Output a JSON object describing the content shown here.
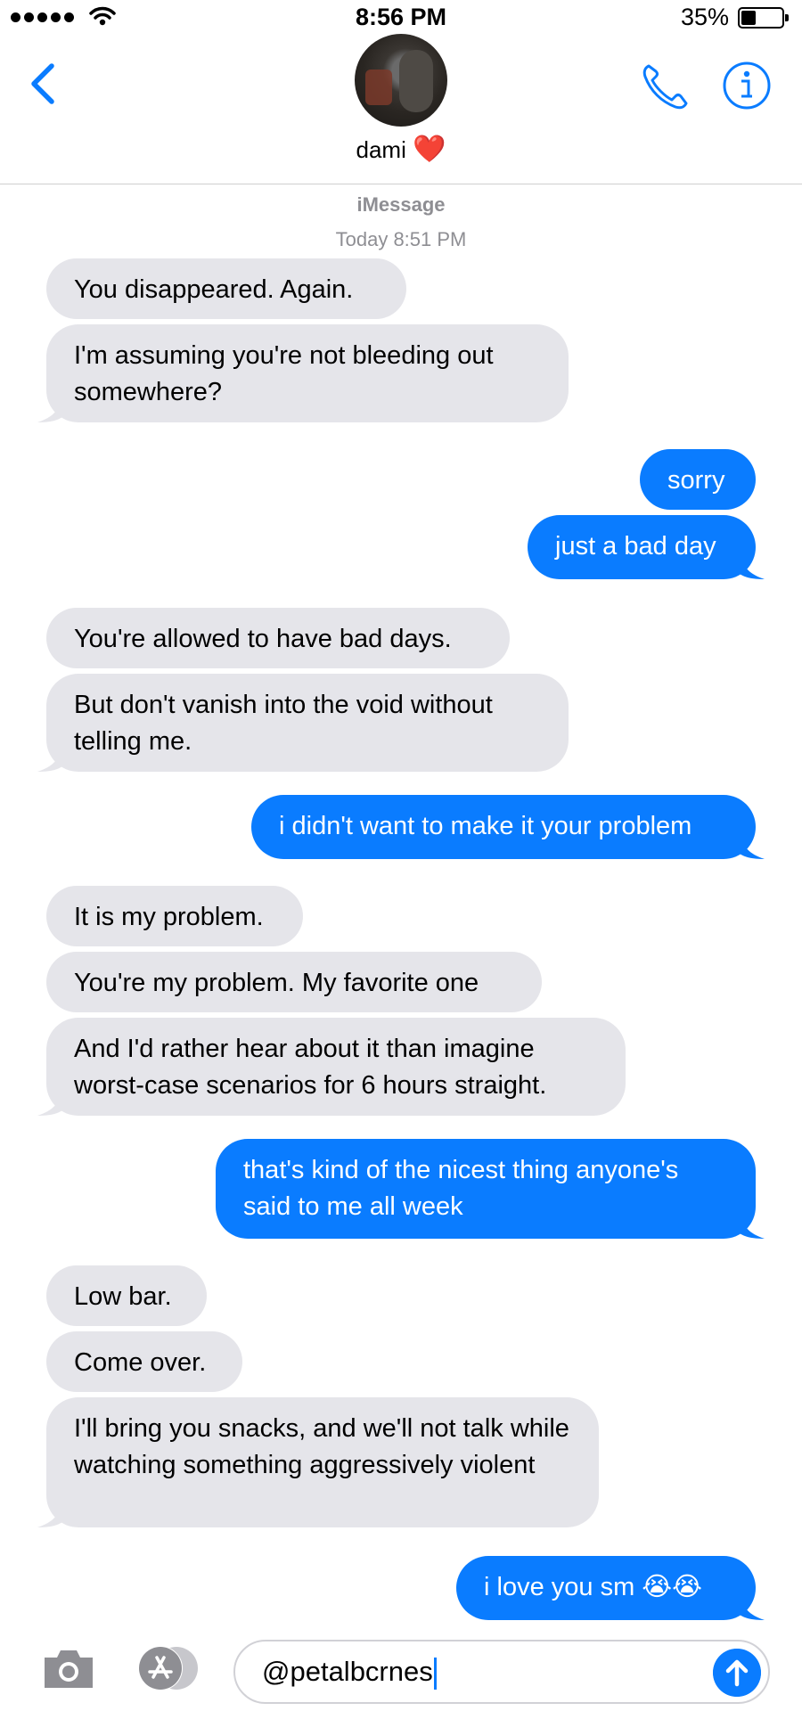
{
  "status_bar": {
    "time": "8:56 PM",
    "battery_percent": "35%",
    "battery_level": 0.35,
    "signal_bars": 5
  },
  "header": {
    "contact_name": "dami",
    "contact_emoji": "❤️",
    "back_icon": "chevron-left-icon",
    "call_icon": "phone-icon",
    "info_icon": "info-icon"
  },
  "thread": {
    "service": "iMessage",
    "timestamp": "Today 8:51 PM"
  },
  "messages": [
    {
      "dir": "in",
      "text": "You disappeared. Again."
    },
    {
      "dir": "in",
      "text": "I'm assuming you're not bleeding out somewhere?"
    },
    {
      "dir": "out",
      "text": "sorry"
    },
    {
      "dir": "out",
      "text": "just a bad day"
    },
    {
      "dir": "in",
      "text": "You're allowed to have bad days."
    },
    {
      "dir": "in",
      "text": "But don't vanish into the void without telling me."
    },
    {
      "dir": "out",
      "text": "i didn't want to make it your problem"
    },
    {
      "dir": "in",
      "text": "It is my problem."
    },
    {
      "dir": "in",
      "text": "You're my problem. My favorite one"
    },
    {
      "dir": "in",
      "text": "And I'd rather hear about it than imagine worst-case scenarios for 6 hours straight."
    },
    {
      "dir": "out",
      "text": "that's kind of the nicest thing anyone's said to me all week"
    },
    {
      "dir": "in",
      "text": "Low bar."
    },
    {
      "dir": "in",
      "text": "Come over."
    },
    {
      "dir": "in",
      "text": "I'll bring you snacks, and we'll not talk while watching something aggressively violent"
    },
    {
      "dir": "out",
      "text": "i love you sm 😭😭"
    }
  ],
  "composer": {
    "value": "@petalbcrnes",
    "camera_icon": "camera-icon",
    "apps_icon": "app-store-icon",
    "send_icon": "send-arrow-icon"
  },
  "colors": {
    "incoming": "#e5e5ea",
    "outgoing": "#0a7cff",
    "accent": "#0a7cff"
  }
}
